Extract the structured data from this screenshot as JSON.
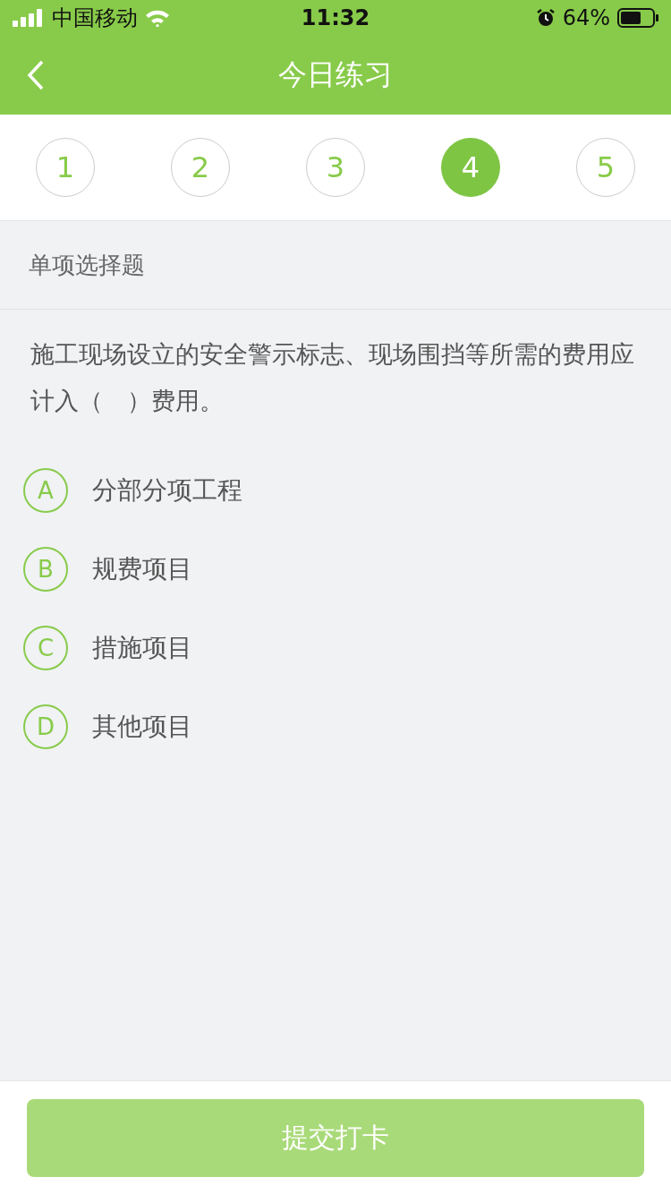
{
  "status_bar": {
    "carrier": "中国移动",
    "time": "11:32",
    "battery": "64%"
  },
  "nav": {
    "title": "今日练习"
  },
  "steps": [
    {
      "label": "1",
      "selected": false
    },
    {
      "label": "2",
      "selected": false
    },
    {
      "label": "3",
      "selected": false
    },
    {
      "label": "4",
      "selected": true
    },
    {
      "label": "5",
      "selected": false
    }
  ],
  "section": "单项选择题",
  "question": "施工现场设立的安全警示标志、现场围挡等所需的费用应计入（　）费用。",
  "options": [
    {
      "letter": "A",
      "text": "分部分项工程",
      "selected": false
    },
    {
      "letter": "B",
      "text": "规费项目",
      "selected": false
    },
    {
      "letter": "C",
      "text": "措施项目",
      "selected": false
    },
    {
      "letter": "D",
      "text": "其他项目",
      "selected": false
    }
  ],
  "submit": {
    "label": "提交打卡",
    "disabled": true
  }
}
